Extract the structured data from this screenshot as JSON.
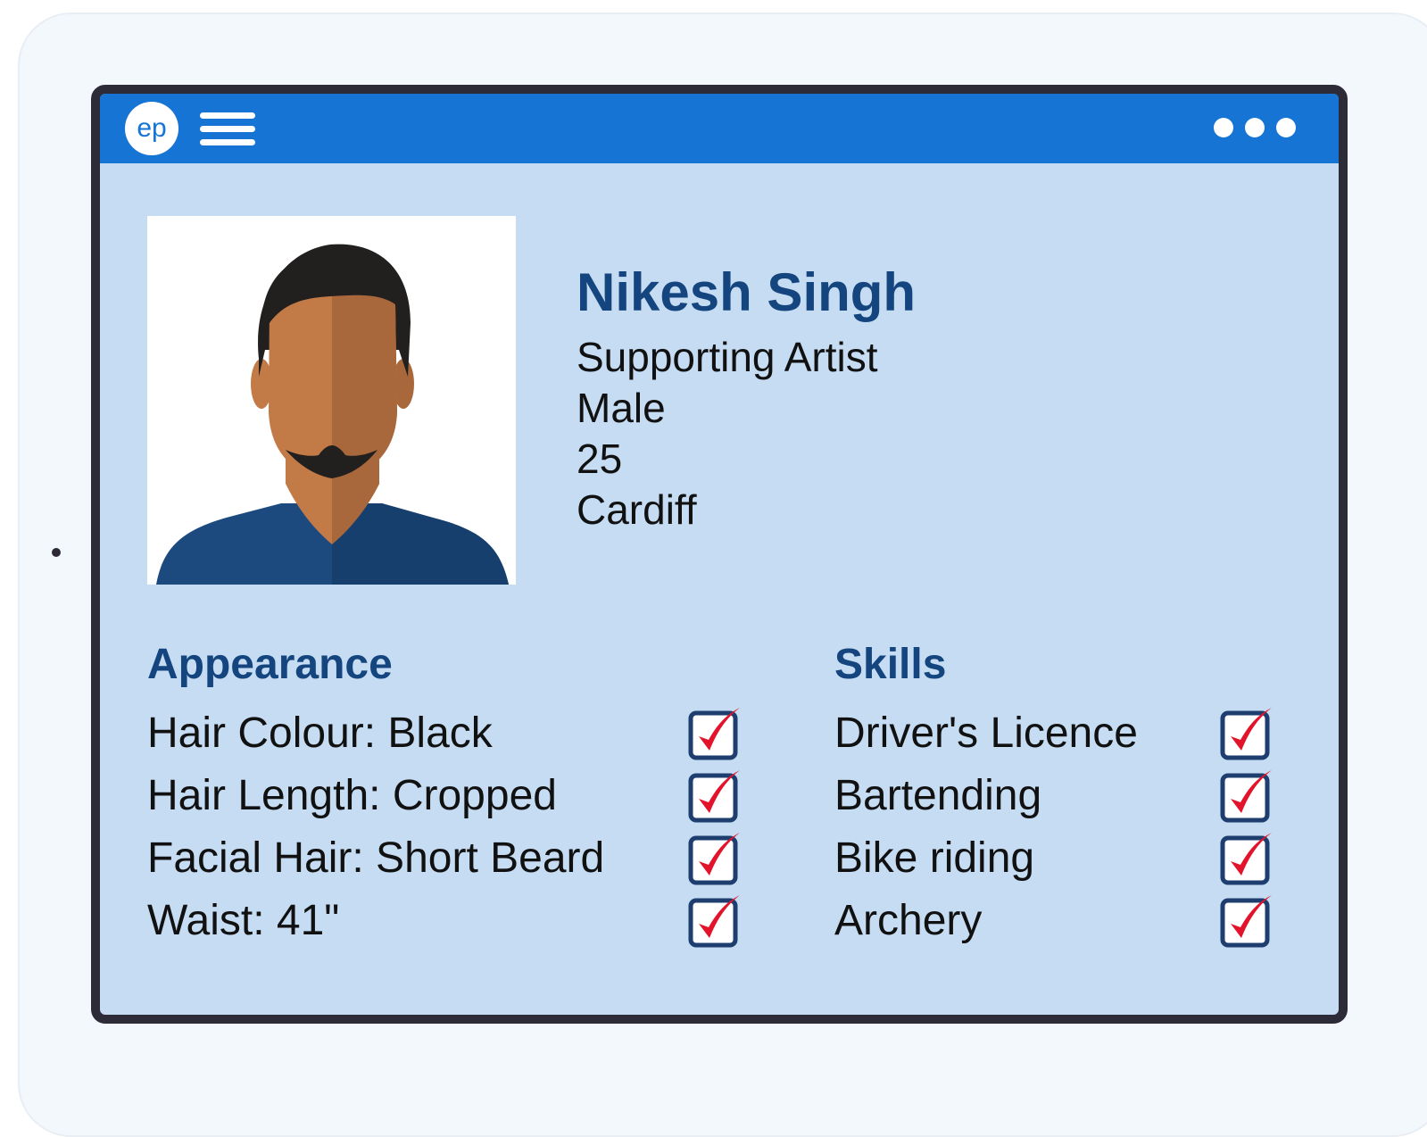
{
  "header": {
    "logo_text": "ep",
    "menu_icon": "hamburger-menu-icon",
    "more_icon": "more-options-icon"
  },
  "profile": {
    "name": "Nikesh Singh",
    "details": [
      "Supporting Artist",
      "Male",
      "25",
      "Cardiff"
    ],
    "avatar_icon": "person-avatar-icon"
  },
  "appearance": {
    "title": "Appearance",
    "items": [
      {
        "label": "Hair Colour: Black",
        "checked": true
      },
      {
        "label": "Hair Length: Cropped",
        "checked": true
      },
      {
        "label": "Facial Hair: Short Beard",
        "checked": true
      },
      {
        "label": "Waist: 41\"",
        "checked": true
      }
    ]
  },
  "skills": {
    "title": "Skills",
    "items": [
      {
        "label": "Driver's Licence",
        "checked": true
      },
      {
        "label": "Bartending",
        "checked": true
      },
      {
        "label": "Bike riding",
        "checked": true
      },
      {
        "label": "Archery",
        "checked": true
      }
    ]
  },
  "colors": {
    "titlebar": "#1574d4",
    "window_bg": "#c5dcf3",
    "heading": "#14457e",
    "checkmark": "#e2132a",
    "checkbox_border": "#1d3e6e"
  }
}
